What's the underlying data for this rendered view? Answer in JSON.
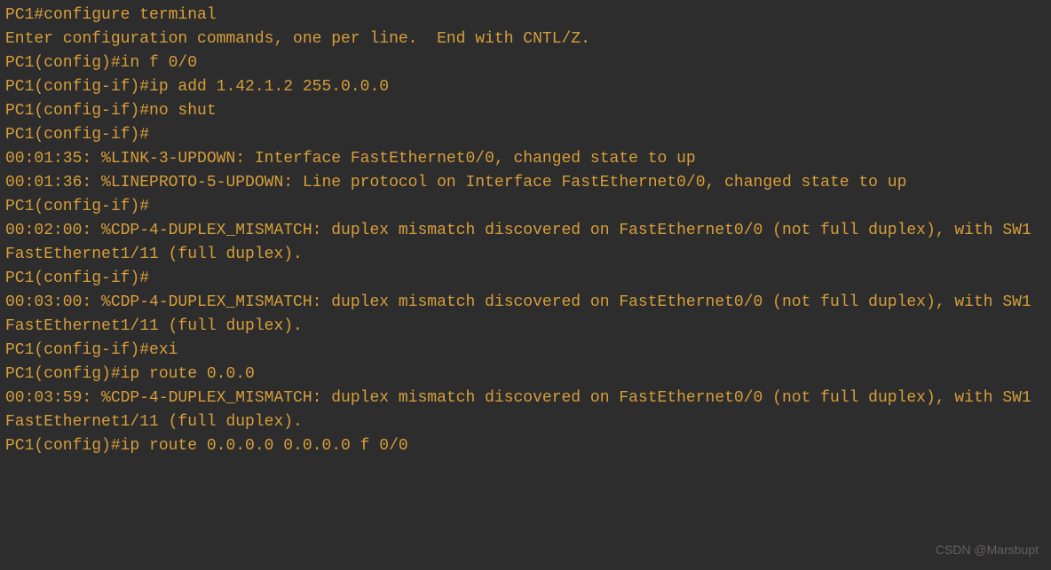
{
  "lines": [
    "PC1#configure terminal",
    "Enter configuration commands, one per line.  End with CNTL/Z.",
    "PC1(config)#in f 0/0",
    "PC1(config-if)#ip add 1.42.1.2 255.0.0.0",
    "PC1(config-if)#no shut",
    "PC1(config-if)#",
    "00:01:35: %LINK-3-UPDOWN: Interface FastEthernet0/0, changed state to up",
    "00:01:36: %LINEPROTO-5-UPDOWN: Line protocol on Interface FastEthernet0/0, changed state to up",
    "PC1(config-if)#",
    "00:02:00: %CDP-4-DUPLEX_MISMATCH: duplex mismatch discovered on FastEthernet0/0 (not full duplex), with SW1 FastEthernet1/11 (full duplex).",
    "PC1(config-if)#",
    "00:03:00: %CDP-4-DUPLEX_MISMATCH: duplex mismatch discovered on FastEthernet0/0 (not full duplex), with SW1 FastEthernet1/11 (full duplex).",
    "PC1(config-if)#exi",
    "PC1(config)#ip route 0.0.0",
    "00:03:59: %CDP-4-DUPLEX_MISMATCH: duplex mismatch discovered on FastEthernet0/0 (not full duplex), with SW1 FastEthernet1/11 (full duplex).",
    "PC1(config)#ip route 0.0.0.0 0.0.0.0 f 0/0"
  ],
  "watermark": "CSDN @Marsbupt"
}
